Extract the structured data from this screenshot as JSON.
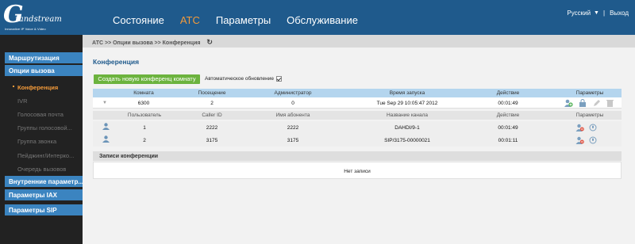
{
  "header": {
    "logo_letter": "G",
    "logo_brand": "randstream",
    "logo_tagline": "Innovative IP Voice & Video",
    "nav": [
      "Состояние",
      "АТС",
      "Параметры",
      "Обслуживание"
    ],
    "active_nav": "АТС",
    "language": "Русский",
    "logout": "Выход",
    "separator": "|",
    "colors": {
      "bar": "#1f5a8c",
      "accent": "#f39a3a"
    }
  },
  "sidebar": {
    "items": [
      {
        "label": "Маршрутизация",
        "type": "head"
      },
      {
        "label": "Опции вызова",
        "type": "head"
      },
      {
        "label": "Конференция",
        "type": "sub",
        "active": true
      },
      {
        "label": "IVR",
        "type": "sub"
      },
      {
        "label": "Голосовая почта",
        "type": "sub"
      },
      {
        "label": "Группы голосовой...",
        "type": "sub"
      },
      {
        "label": "Группа звонка",
        "type": "sub"
      },
      {
        "label": "Пейджинг/Интерко...",
        "type": "sub"
      },
      {
        "label": "Очередь вызовов",
        "type": "sub"
      },
      {
        "label": "Внутренние параметр...",
        "type": "head"
      },
      {
        "label": "Параметры IAX",
        "type": "head"
      },
      {
        "label": "Параметры SIP",
        "type": "head"
      }
    ]
  },
  "breadcrumb": "АТС >> Опции вызова >> Конференция",
  "page_title": "Конференция",
  "create_button": "Создать новую конференц комнату",
  "auto_refresh": {
    "label": "Автоматическое обновление",
    "checked": true
  },
  "conf_table": {
    "headers": [
      "Комната",
      "Посещение",
      "Администратор",
      "Время запуска",
      "Действие",
      "Параметры"
    ],
    "row": {
      "room": "6300",
      "visits": "2",
      "admin": "0",
      "start": "Tue Sep 29 10:05:47 2012",
      "action": "00:01:49"
    }
  },
  "participants": {
    "headers": [
      "Пользователь",
      "Caller ID",
      "Имя абонента",
      "Название канала",
      "Действие",
      "Параметры"
    ],
    "rows": [
      {
        "user": "1",
        "caller_id": "2222",
        "name": "2222",
        "channel": "DAHDI/9-1",
        "action": "00:01:49"
      },
      {
        "user": "2",
        "caller_id": "3175",
        "name": "3175",
        "channel": "SIP/3175-00000021",
        "action": "00:01:11"
      }
    ]
  },
  "records": {
    "title": "Записи конференции",
    "empty": "Нет записи"
  }
}
